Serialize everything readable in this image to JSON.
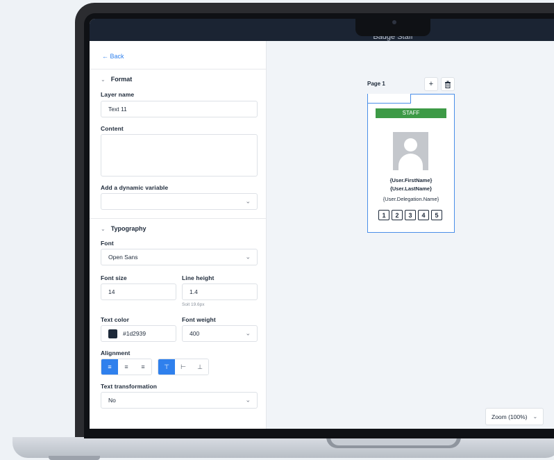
{
  "topbar": {
    "title": "Badge Staff"
  },
  "panel": {
    "back_label": "← Back",
    "format": {
      "header": "Format",
      "layer_name_label": "Layer name",
      "layer_name_value": "Text 11",
      "content_label": "Content",
      "content_value": "",
      "dynamic_var_label": "Add a dynamic variable",
      "dynamic_var_value": ""
    },
    "typography": {
      "header": "Typography",
      "font_label": "Font",
      "font_value": "Open Sans",
      "font_size_label": "Font size",
      "font_size_value": "14",
      "line_height_label": "Line height",
      "line_height_value": "1.4",
      "line_height_hint": "Soit 19.6px",
      "text_color_label": "Text color",
      "text_color_value": "#1d2939",
      "font_weight_label": "Font weight",
      "font_weight_value": "400",
      "alignment_label": "Alignment",
      "horizontal_alignment": "left",
      "vertical_alignment": "top",
      "text_transform_label": "Text transformation",
      "text_transform_value": "No"
    }
  },
  "canvas": {
    "page_label": "Page 1",
    "badge": {
      "header_text": "STAFF",
      "header_color": "#3d9a46",
      "first_name": "{User.FirstName}",
      "last_name": "{User.LastName}",
      "delegation": "{User.Delegation.Name}",
      "numbers": [
        "1",
        "2",
        "3",
        "4",
        "5"
      ]
    },
    "zoom_label": "Zoom (100%)"
  },
  "colors": {
    "accent": "#2f80ed",
    "text": "#1d2939",
    "topbar": "#1b2433"
  }
}
